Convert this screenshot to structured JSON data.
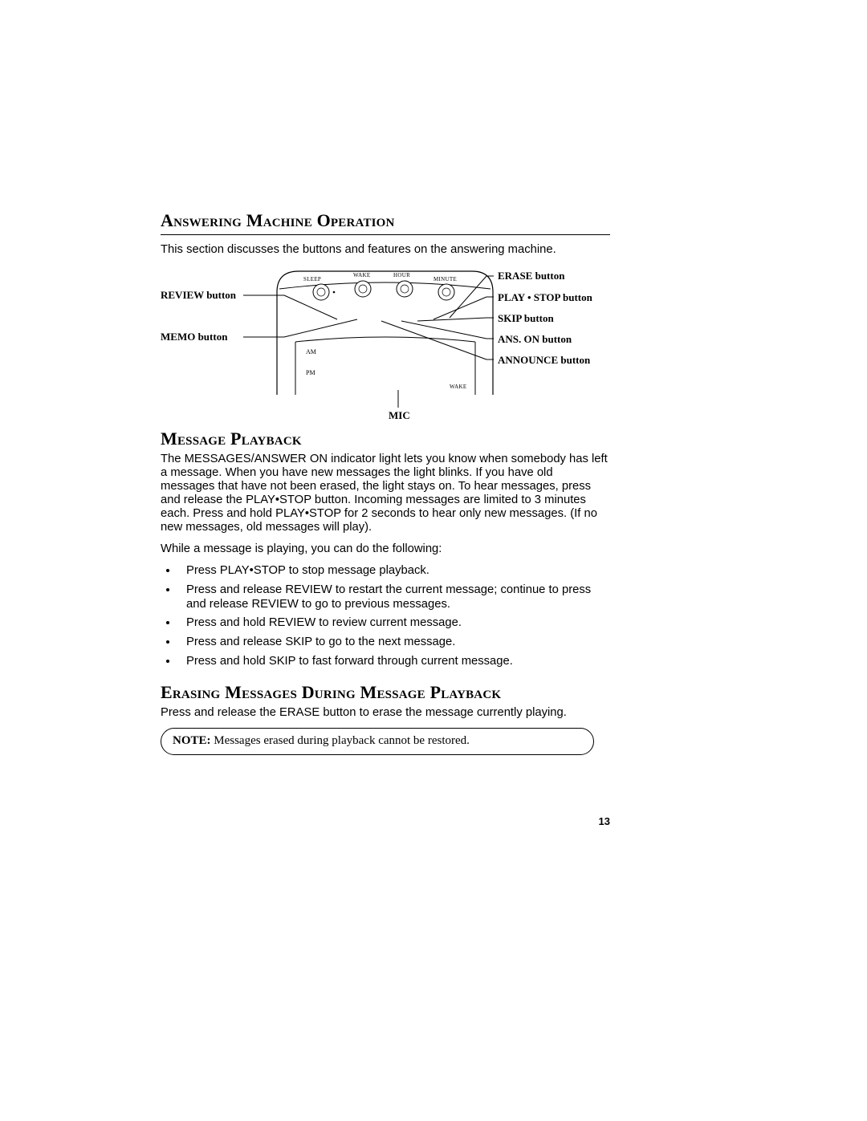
{
  "page_number": "13",
  "sections": {
    "answering_machine": {
      "title": "Answering Machine Operation",
      "intro": "This section discusses the buttons and features on the answering machine."
    },
    "message_playback": {
      "title": "Message Playback",
      "para1": "The MESSAGES/ANSWER ON indicator light lets you know when somebody has left a message. When you have new messages the light blinks. If you have old messages that have not been erased, the light stays on. To hear messages, press and release the PLAY•STOP button. Incoming messages are limited to 3 minutes each. Press and hold PLAY•STOP for 2 seconds to hear only new messages. (If no new messages, old messages will play).",
      "para2": "While a message is playing, you can do the following:",
      "bullets": [
        "Press PLAY•STOP to stop message playback.",
        "Press and release REVIEW to restart the current message; continue to press and release REVIEW to go to previous messages.",
        "Press and hold REVIEW to review current message.",
        "Press and release SKIP to go to the next message.",
        "Press and hold SKIP to fast forward through current message."
      ]
    },
    "erasing": {
      "title": "Erasing Messages During Message Playback",
      "para": "Press and release the ERASE button to erase the message currently playing."
    },
    "note": {
      "bold": "NOTE: ",
      "text": "Messages erased during playback cannot be restored."
    }
  },
  "diagram": {
    "left_labels": {
      "review": "REVIEW button",
      "memo": "MEMO  button"
    },
    "right_labels": {
      "erase": "ERASE button",
      "play_stop": "PLAY • STOP button",
      "skip": "SKIP button",
      "ans_on": "ANS. ON  button",
      "announce": "ANNOUNCE  button"
    },
    "bottom_label": "MIC",
    "button_text": {
      "sleep": "SLEEP",
      "wake": "WAKE",
      "hour": "HOUR",
      "minute": "MINUTE",
      "am": "AM",
      "pm": "PM",
      "wake2": "WAKE"
    }
  }
}
